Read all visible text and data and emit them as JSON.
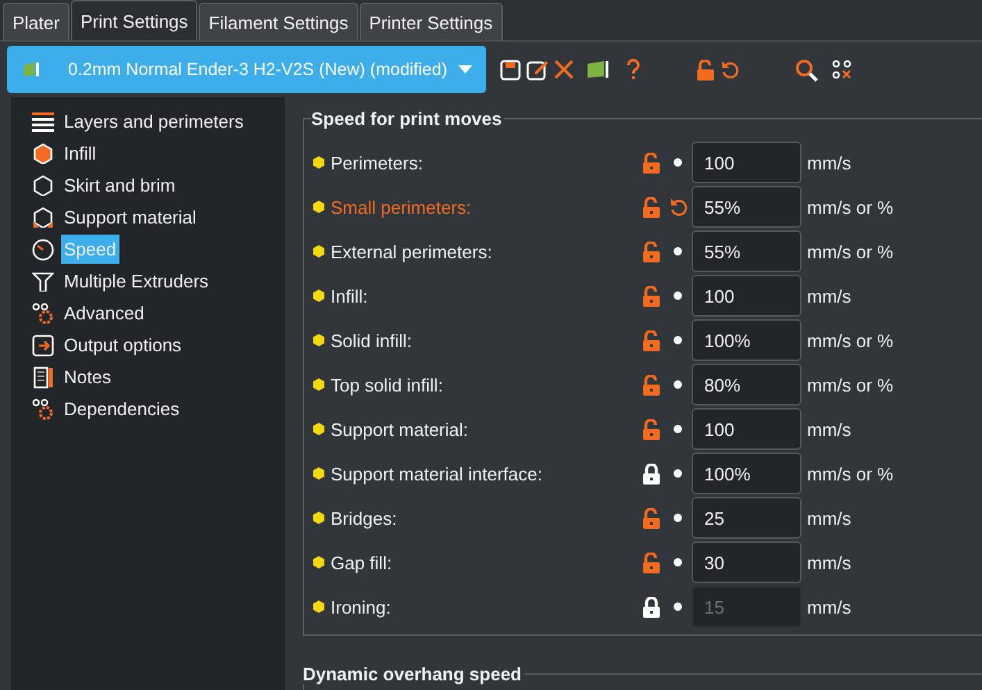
{
  "tabs": [
    {
      "label": "Plater",
      "selected": false
    },
    {
      "label": "Print Settings",
      "selected": true
    },
    {
      "label": "Filament Settings",
      "selected": false
    },
    {
      "label": "Printer Settings",
      "selected": false
    }
  ],
  "preset": {
    "name": "0.2mm Normal Ender-3 H2-V2S (New) (modified)"
  },
  "sidebar": {
    "items": [
      {
        "label": "Layers and perimeters",
        "selected": false
      },
      {
        "label": "Infill",
        "selected": false
      },
      {
        "label": "Skirt and brim",
        "selected": false
      },
      {
        "label": "Support material",
        "selected": false
      },
      {
        "label": "Speed",
        "selected": true
      },
      {
        "label": "Multiple Extruders",
        "selected": false
      },
      {
        "label": "Advanced",
        "selected": false
      },
      {
        "label": "Output options",
        "selected": false
      },
      {
        "label": "Notes",
        "selected": false
      },
      {
        "label": "Dependencies",
        "selected": false
      }
    ]
  },
  "groups": [
    {
      "title": "Speed for print moves",
      "rows": [
        {
          "label": "Perimeters:",
          "modified": false,
          "locked": false,
          "value": "100",
          "unit": "mm/s",
          "disabled": false
        },
        {
          "label": "Small perimeters:",
          "modified": true,
          "locked": false,
          "value": "55%",
          "unit": "mm/s or %",
          "disabled": false
        },
        {
          "label": "External perimeters:",
          "modified": false,
          "locked": false,
          "value": "55%",
          "unit": "mm/s or %",
          "disabled": false
        },
        {
          "label": "Infill:",
          "modified": false,
          "locked": false,
          "value": "100",
          "unit": "mm/s",
          "disabled": false
        },
        {
          "label": "Solid infill:",
          "modified": false,
          "locked": false,
          "value": "100%",
          "unit": "mm/s or %",
          "disabled": false
        },
        {
          "label": "Top solid infill:",
          "modified": false,
          "locked": false,
          "value": "80%",
          "unit": "mm/s or %",
          "disabled": false
        },
        {
          "label": "Support material:",
          "modified": false,
          "locked": false,
          "value": "100",
          "unit": "mm/s",
          "disabled": false
        },
        {
          "label": "Support material interface:",
          "modified": false,
          "locked": true,
          "value": "100%",
          "unit": "mm/s or %",
          "disabled": false
        },
        {
          "label": "Bridges:",
          "modified": false,
          "locked": false,
          "value": "25",
          "unit": "mm/s",
          "disabled": false
        },
        {
          "label": "Gap fill:",
          "modified": false,
          "locked": false,
          "value": "30",
          "unit": "mm/s",
          "disabled": false
        },
        {
          "label": "Ironing:",
          "modified": false,
          "locked": true,
          "value": "15",
          "unit": "mm/s",
          "disabled": true
        }
      ]
    },
    {
      "title": "Dynamic overhang speed"
    }
  ]
}
